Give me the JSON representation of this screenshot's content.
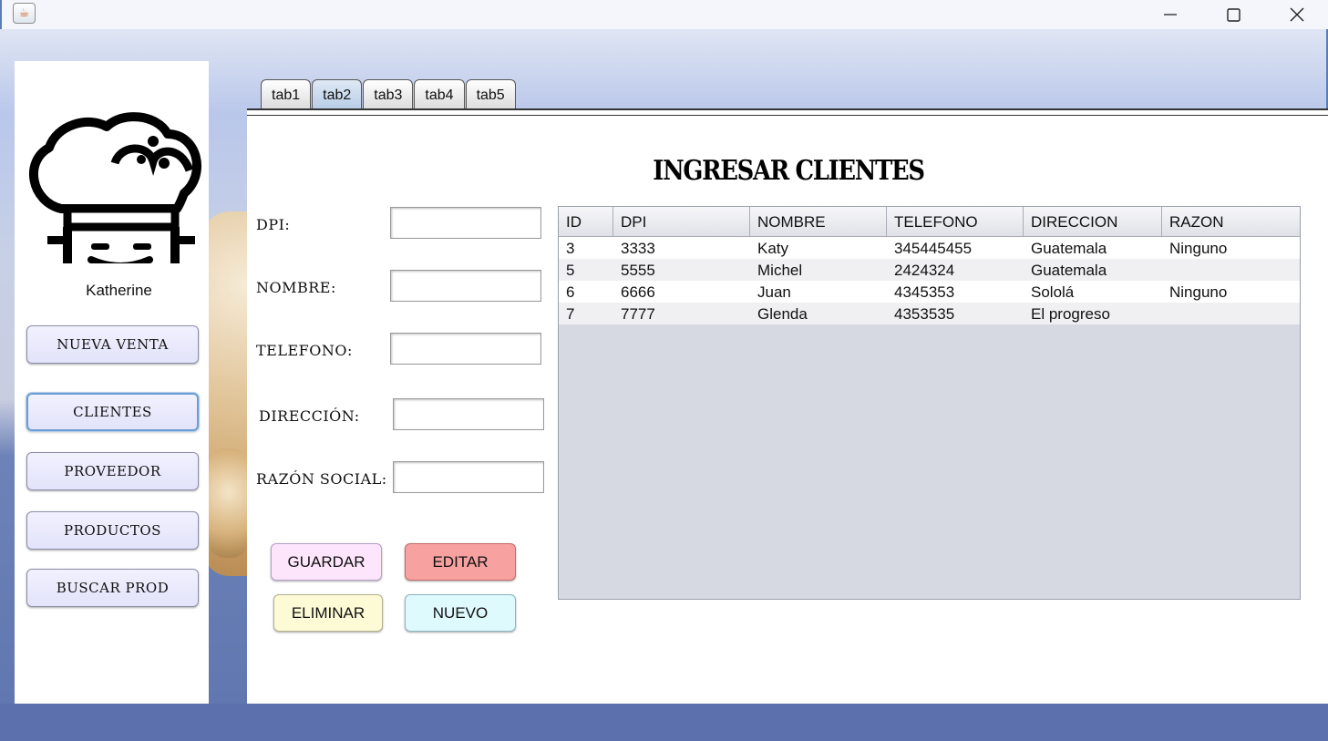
{
  "window": {
    "app_icon": "java-cup-icon"
  },
  "sidebar": {
    "logo_icon": "chef-hat-icon",
    "username": "Katherine",
    "buttons": [
      {
        "label": "NUEVA VENTA"
      },
      {
        "label": "CLIENTES"
      },
      {
        "label": "PROVEEDOR"
      },
      {
        "label": "PRODUCTOS"
      },
      {
        "label": "BUSCAR PROD"
      }
    ]
  },
  "tabs": [
    "tab1",
    "tab2",
    "tab3",
    "tab4",
    "tab5"
  ],
  "active_tab": "tab2",
  "form": {
    "title": "INGRESAR CLIENTES",
    "fields": [
      {
        "label": "DPI:",
        "value": ""
      },
      {
        "label": "NOMBRE:",
        "value": ""
      },
      {
        "label": "TELEFONO:",
        "value": ""
      },
      {
        "label": "DIRECCIÓN:",
        "value": ""
      },
      {
        "label": "RAZÓN SOCIAL:",
        "value": ""
      }
    ],
    "buttons": {
      "guardar": "GUARDAR",
      "editar": "EDITAR",
      "eliminar": "ELIMINAR",
      "nuevo": "NUEVO"
    },
    "button_colors": {
      "guardar": "#fde5fb",
      "editar": "#f7a1a1",
      "eliminar": "#fdfad6",
      "nuevo": "#dffafc"
    }
  },
  "table": {
    "columns": [
      "ID",
      "DPI",
      "NOMBRE",
      "TELEFONO",
      "DIRECCION",
      "RAZON"
    ],
    "rows": [
      [
        "3",
        "3333",
        "Katy",
        "345445455",
        "Guatemala",
        "Ninguno"
      ],
      [
        "5",
        "5555",
        "Michel",
        "2424324",
        "Guatemala",
        ""
      ],
      [
        "6",
        "6666",
        "Juan",
        "4345353",
        "Sololá",
        "Ninguno"
      ],
      [
        "7",
        "7777",
        "Glenda",
        "4353535",
        "El progreso",
        ""
      ]
    ]
  }
}
